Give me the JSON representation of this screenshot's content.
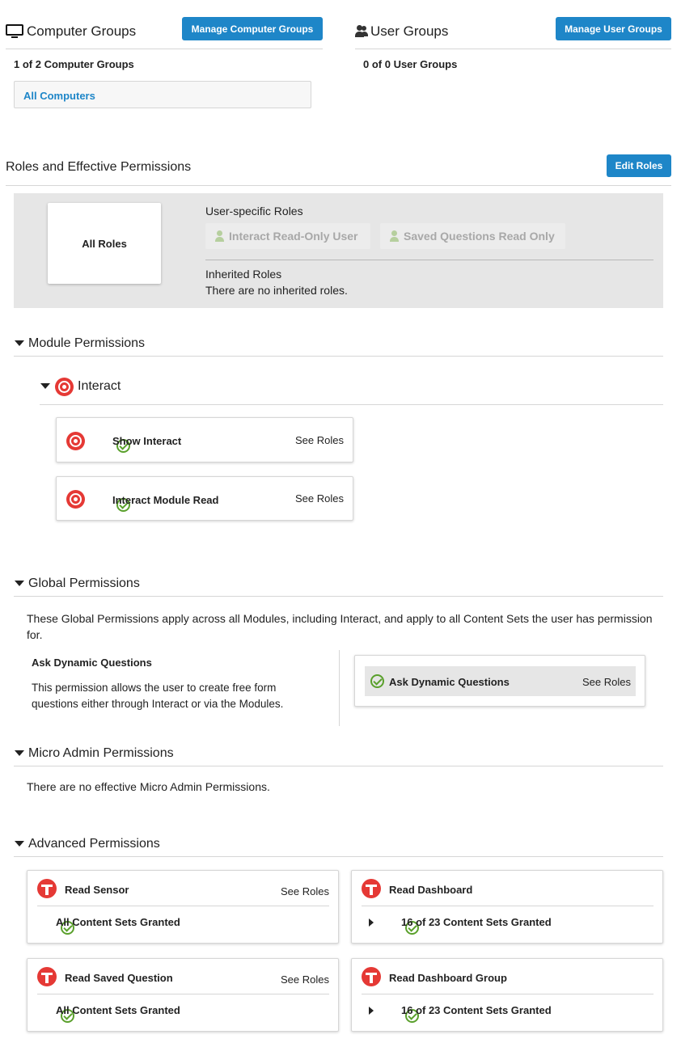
{
  "computer_groups": {
    "title": "Computer Groups",
    "manage_button": "Manage Computer Groups",
    "count": "1 of 2 Computer Groups",
    "items": [
      "All Computers"
    ]
  },
  "user_groups": {
    "title": "User Groups",
    "manage_button": "Manage User Groups",
    "count": "0 of 0 User Groups"
  },
  "roles": {
    "title": "Roles and Effective Permissions",
    "edit_button": "Edit Roles",
    "all_roles": "All Roles",
    "user_specific_label": "User-specific Roles",
    "user_specific": [
      "Interact Read-Only User",
      "Saved Questions Read Only"
    ],
    "inherited_label": "Inherited Roles",
    "inherited_text": "There are no inherited roles."
  },
  "module_permissions": {
    "title": "Module Permissions",
    "module_name": "Interact",
    "items": [
      {
        "label": "Show Interact",
        "link": "See Roles"
      },
      {
        "label": "Interact Module Read",
        "link": "See Roles"
      }
    ]
  },
  "global_permissions": {
    "title": "Global Permissions",
    "description": "These Global Permissions apply across all Modules, including Interact, and apply to all Content Sets the user has permission for.",
    "perm_title": "Ask Dynamic Questions",
    "perm_desc": "This permission allows the user to create free form questions either through Interact or via the Modules.",
    "card_label": "Ask Dynamic Questions",
    "card_link": "See Roles"
  },
  "micro_admin": {
    "title": "Micro Admin Permissions",
    "text": "There are no effective Micro Admin Permissions."
  },
  "advanced": {
    "title": "Advanced Permissions",
    "cards": [
      {
        "title": "Read Sensor",
        "link": "See Roles",
        "status": "All Content Sets Granted"
      },
      {
        "title": "Read Dashboard",
        "link": "",
        "status": "16 of 23 Content Sets Granted"
      },
      {
        "title": "Read Saved Question",
        "link": "See Roles",
        "status": "All Content Sets Granted"
      },
      {
        "title": "Read Dashboard Group",
        "link": "",
        "status": "16 of 23 Content Sets Granted"
      }
    ]
  },
  "colors": {
    "primary_button": "#1e86c8",
    "link_blue": "#1e86c8",
    "success_green": "#5aa02c",
    "brand_red": "#e53935",
    "panel_gray": "#e6e6e6"
  }
}
